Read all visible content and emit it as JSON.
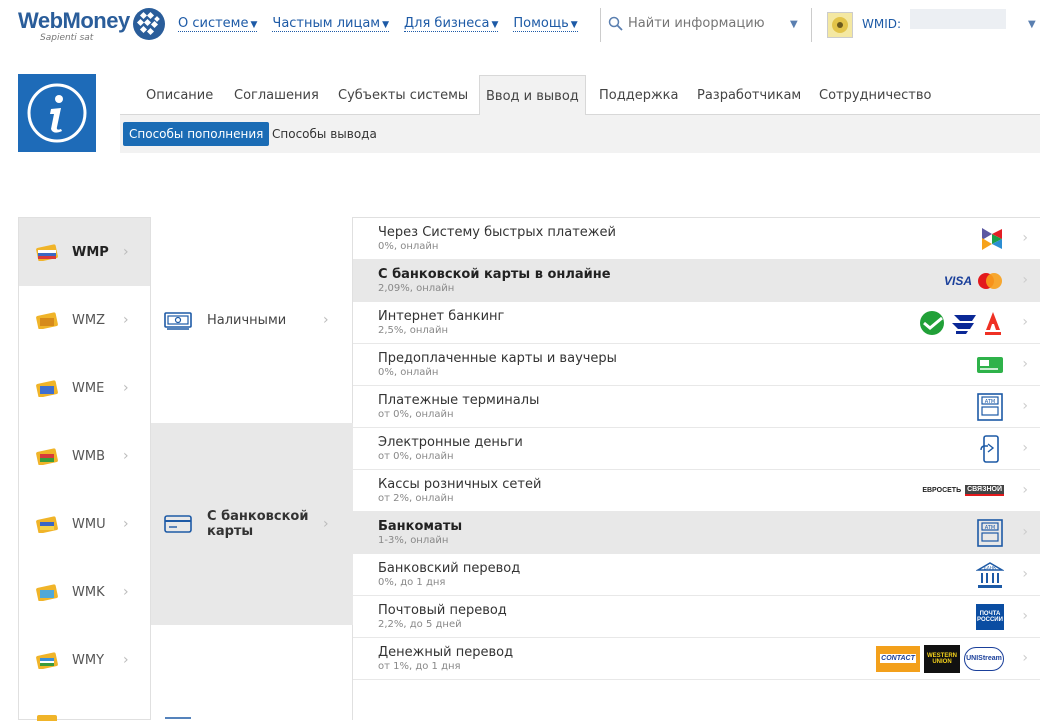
{
  "header": {
    "logo_name": "WebMoney",
    "logo_tagline": "Sapienti sat",
    "nav": [
      {
        "label": "О системе"
      },
      {
        "label": "Частным лицам"
      },
      {
        "label": "Для бизнеса"
      },
      {
        "label": "Помощь"
      }
    ],
    "search_placeholder": "Найти информацию",
    "wmid_label": "WMID:"
  },
  "tabs": [
    "Описание",
    "Соглашения",
    "Субъекты системы",
    "Ввод и вывод",
    "Поддержка",
    "Разработчикам",
    "Сотрудничество"
  ],
  "active_tab": "Ввод и вывод",
  "subtabs": [
    "Способы пополнения",
    "Способы вывода"
  ],
  "active_subtab": "Способы пополнения",
  "currencies": [
    "WMP",
    "WMZ",
    "WME",
    "WMB",
    "WMU",
    "WMK",
    "WMY"
  ],
  "active_currency": "WMP",
  "methods": [
    "Наличными",
    "С банковской карты"
  ],
  "active_method": "С банковской карты",
  "options": [
    {
      "title": "Через Систему быстрых платежей",
      "sub": "0%, онлайн",
      "logo": "sbp-logo"
    },
    {
      "title": "С банковской карты в онлайне",
      "sub": "2,09%, онлайн",
      "logo": "visa-mastercard-logo"
    },
    {
      "title": "Интернет банкинг",
      "sub": "2,5%, онлайн",
      "logo": "sber-vtb-alfa-logo"
    },
    {
      "title": "Предоплаченные карты и ваучеры",
      "sub": "0%, онлайн",
      "logo": "card-icon"
    },
    {
      "title": "Платежные терминалы",
      "sub": "от 0%, онлайн",
      "logo": "atm-icon"
    },
    {
      "title": "Электронные деньги",
      "sub": "от 0%, онлайн",
      "logo": "phone-icon"
    },
    {
      "title": "Кассы розничных сетей",
      "sub": "от 2%, онлайн",
      "logo": "euroset-svyaznoy-logo"
    },
    {
      "title": "Банкоматы",
      "sub": "1-3%, онлайн",
      "logo": "atm-icon"
    },
    {
      "title": "Банковский перевод",
      "sub": "0%, до 1 дня",
      "logo": "bank-icon"
    },
    {
      "title": "Почтовый перевод",
      "sub": "2,2%, до 5 дней",
      "logo": "russian-post-logo"
    },
    {
      "title": "Денежный перевод",
      "sub": "от 1%, до 1 дня",
      "logo": "contact-wu-unistream-logo"
    }
  ],
  "active_options": [
    1,
    7
  ],
  "brand_labels": {
    "visa": "VISA",
    "euroset": "ЕВРОСЕТЬ",
    "svyaznoy": "СВЯЗНОЙ",
    "post_line1": "ПОЧТА",
    "post_line2": "РОССИИ",
    "contact": "CONTACT",
    "wu_line1": "WESTERN",
    "wu_line2": "UNION",
    "unistream": "UNIStream",
    "atm": "ATM",
    "bank": "БАНК"
  },
  "colors": {
    "brand_blue": "#1e6bb8",
    "link_blue": "#1d5aa6",
    "active_bg": "#e8e8e8",
    "subtab_active": "#1b6cb5"
  }
}
